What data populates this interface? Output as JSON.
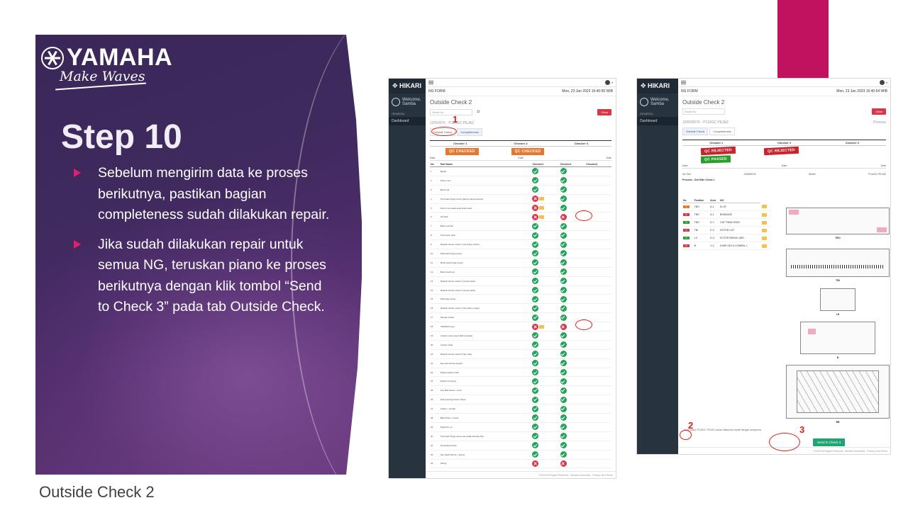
{
  "slide": {
    "brand": "YAMAHA",
    "tagline": "Make Waves",
    "title": "Step 10",
    "bullets": [
      "Sebelum mengirim data ke proses berikutnya, pastikan bagian completeness sudah dilakukan repair.",
      "Jika sudah dilakukan repair untuk semua NG, teruskan piano ke proses berikutnya dengan klik tombol “Send to Check 3” pada tab Outside Check."
    ],
    "caption": "Outside Check 2",
    "colors": {
      "panel": "#3f2a5e",
      "accent": "#c0125f",
      "bullet": "#e0206e",
      "annotation": "#e21b1b"
    }
  },
  "screenshot_left": {
    "app": "HIKARI",
    "user": "Welcome, Samba",
    "nav_section": "GENERAL",
    "nav_item": "Dashboard",
    "form_label": "NG FORM",
    "date_time": "Mon, 23 Jan 2023 15:40:50 WIB",
    "page_title": "Outside Check 2",
    "serial_placeholder": "Serial No",
    "clear_label": "Clear",
    "model_line": "J2050075 - P116GC PEJAZ",
    "tabs": [
      "Outside Check",
      "Completeness"
    ],
    "checkers": [
      "Checker 1",
      "Checker 2",
      "Checker 3"
    ],
    "stamp": "QC CHECKED",
    "columns": [
      "No",
      "Part Name",
      "Checker1",
      "Checker2",
      "Checker3"
    ],
    "annotation": "1",
    "parts": [
      {
        "no": "1",
        "name": "Model",
        "c1": "ok",
        "c2": "ok",
        "tag": false
      },
      {
        "no": "2",
        "name": "Nomor seri",
        "c1": "ok",
        "c2": "ok",
        "tag": false
      },
      {
        "no": "3",
        "name": "Bench lid",
        "c1": "ok",
        "c2": "ok",
        "tag": false
      },
      {
        "no": "4",
        "name": "Top board hinge screw (damn/ panel tertentu)",
        "c1": "ng",
        "c2": "ok",
        "tag": true
      },
      {
        "no": "5",
        "name": "Nomor seri pada engk side board",
        "c1": "ng",
        "c2": "ok",
        "tag": true
      },
      {
        "no": "6",
        "name": "Lift stick",
        "c1": "ng",
        "c2": "ng",
        "tag": true
      },
      {
        "no": "7",
        "name": "Back post felt",
        "c1": "ok",
        "c2": "ok",
        "tag": false
      },
      {
        "no": "8",
        "name": "Top Frame rack",
        "c1": "ok",
        "c2": "ok",
        "tag": false
      },
      {
        "no": "9",
        "name": "Rodotin bunter center 1 (tur frame closer)",
        "c1": "ok",
        "c2": "ok",
        "tag": false
      },
      {
        "no": "10",
        "name": "Fall board hinge screw",
        "c1": "ok",
        "c2": "ok",
        "tag": false
      },
      {
        "no": "11",
        "name": "Music desk hinge screw",
        "c1": "ok",
        "c2": "ok",
        "tag": false
      },
      {
        "no": "12",
        "name": "Music desk set",
        "c1": "ok",
        "c2": "ok",
        "tag": false
      },
      {
        "no": "13",
        "name": "Rodotin bunter center 2 (music desk)",
        "c1": "ok",
        "c2": "ok",
        "tag": false
      },
      {
        "no": "14",
        "name": "Rodotin bunter center 3 (music desk)",
        "c1": "ok",
        "c2": "ok",
        "tag": false
      },
      {
        "no": "15",
        "name": "Fall hinge screw",
        "c1": "ok",
        "c2": "ok",
        "tag": false
      },
      {
        "no": "16",
        "name": "Rodotin bunter center 4 (top frame magn)",
        "c1": "ok",
        "c2": "ok",
        "tag": false
      },
      {
        "no": "17",
        "name": "Sample sticker",
        "c1": "ok",
        "c2": "ok",
        "tag": false
      },
      {
        "no": "18",
        "name": "YAMAHA Logo",
        "c1": "ng",
        "c2": "ng",
        "tag": true
      },
      {
        "no": "19",
        "name": "Custom name tag & label tersedia",
        "c1": "ok",
        "c2": "ok",
        "tag": false
      },
      {
        "no": "20",
        "name": "Custom Seat",
        "c1": "ok",
        "c2": "ok",
        "tag": false
      },
      {
        "no": "21",
        "name": "Rodotin bunter center 5 (key slip)",
        "c1": "ok",
        "c2": "ok",
        "tag": false
      },
      {
        "no": "22",
        "name": "Key-bed shows support",
        "c1": "ok",
        "c2": "ok",
        "tag": false
      },
      {
        "no": "23",
        "name": "Pedal cushion cloth",
        "c1": "ok",
        "c2": "ok",
        "tag": false
      },
      {
        "no": "24",
        "name": "Pedal rod spring",
        "c1": "ok",
        "c2": "ok",
        "tag": false
      },
      {
        "no": "25",
        "name": "Key Bed stand + cover",
        "c1": "ok",
        "c2": "ok",
        "tag": false
      },
      {
        "no": "26",
        "name": "Screw spring bottom frame",
        "c1": "ok",
        "c2": "ok",
        "tag": false
      },
      {
        "no": "27",
        "name": "Caster + sender",
        "c1": "ok",
        "c2": "ok",
        "tag": false
      },
      {
        "no": "28",
        "name": "Back 5/nut + screw",
        "c1": "ok",
        "c2": "ok",
        "tag": false
      },
      {
        "no": "29",
        "name": "Pedal 5/n +1",
        "c1": "ok",
        "c2": "ok",
        "tag": false
      },
      {
        "no": "30",
        "name": "Top board hinge screw nat sudah tertutup bolt",
        "c1": "ok",
        "c2": "ok",
        "tag": false
      },
      {
        "no": "31",
        "name": "Grounding button",
        "c1": "ok",
        "c2": "ok",
        "tag": false
      },
      {
        "no": "32",
        "name": "Key Stoph Shoot + Screw",
        "c1": "ok",
        "c2": "ok",
        "tag": false
      },
      {
        "no": "33",
        "name": "Wiring",
        "c1": "ng",
        "c2": "ng",
        "tag": false
      }
    ],
    "footer": "©2023 All Rights Reserved. Yamaha Indonesia - Privacy and Terms"
  },
  "screenshot_right": {
    "app": "HIKARI",
    "user": "Welcome, Samba",
    "nav_section": "GENERAL",
    "nav_item": "Dashboard",
    "form_label": "NG FORM",
    "date_time": "Mon, 23 Jan 2023 15:40:54 WIB",
    "page_title": "Outside Check 2",
    "serial_placeholder": "Serial No",
    "clear_label": "Clear",
    "model_line": "J20505076 - P116GC PEJAZ",
    "process_label": "Process",
    "tabs": [
      "Outside Check",
      "Completeness"
    ],
    "checkers": [
      "Checker 1",
      "Checker 2",
      "Checker 3"
    ],
    "stamps": [
      "QC REJECTED",
      "QC REJECTED",
      "QC PASSED"
    ],
    "serial_label": "No Seri",
    "serial_value": "J20505076",
    "model_label": "Model",
    "model_value": "P116GC PEJAZ",
    "process_line": "Process : Out Side Check 1",
    "defect_columns": [
      "No",
      "Position",
      "Area",
      "NG"
    ],
    "defects": [
      {
        "no": "1",
        "pos": "TBO",
        "area": "A-1",
        "ng": "KLJR",
        "color": "#e8762b"
      },
      {
        "no": "2",
        "pos": "TBO",
        "area": "A-1",
        "ng": "BOMVASE",
        "color": "#d9354a"
      },
      {
        "no": "3",
        "pos": "TBO",
        "area": "D-7",
        "ng": "CAT TIDAK RATA",
        "color": "#2a9d2f"
      },
      {
        "no": "4",
        "pos": "TBI",
        "area": "D-3",
        "ng": "KOTOR CAT",
        "color": "#d9354a"
      },
      {
        "no": "5",
        "pos": "LH",
        "area": "D-3",
        "ng": "KOTOR BEKAS JARI",
        "color": "#2a9d2f"
      },
      {
        "no": "6",
        "pos": "B",
        "area": "C-2",
        "ng": "KARE KECIL KOMPAL L",
        "color": "#d9354a"
      }
    ],
    "diagram_labels": [
      "TBO",
      "TBI",
      "LH",
      "B",
      "BB"
    ],
    "send_note": "Kirim piano P116GC PEJAZ sudah dilakukan repair dengan sempurna",
    "send_label": "Send to Check 3",
    "annotations": [
      "2",
      "3"
    ],
    "footer": "©2023 All Rights Reserved. Yamaha Indonesia - Privacy and Terms"
  }
}
